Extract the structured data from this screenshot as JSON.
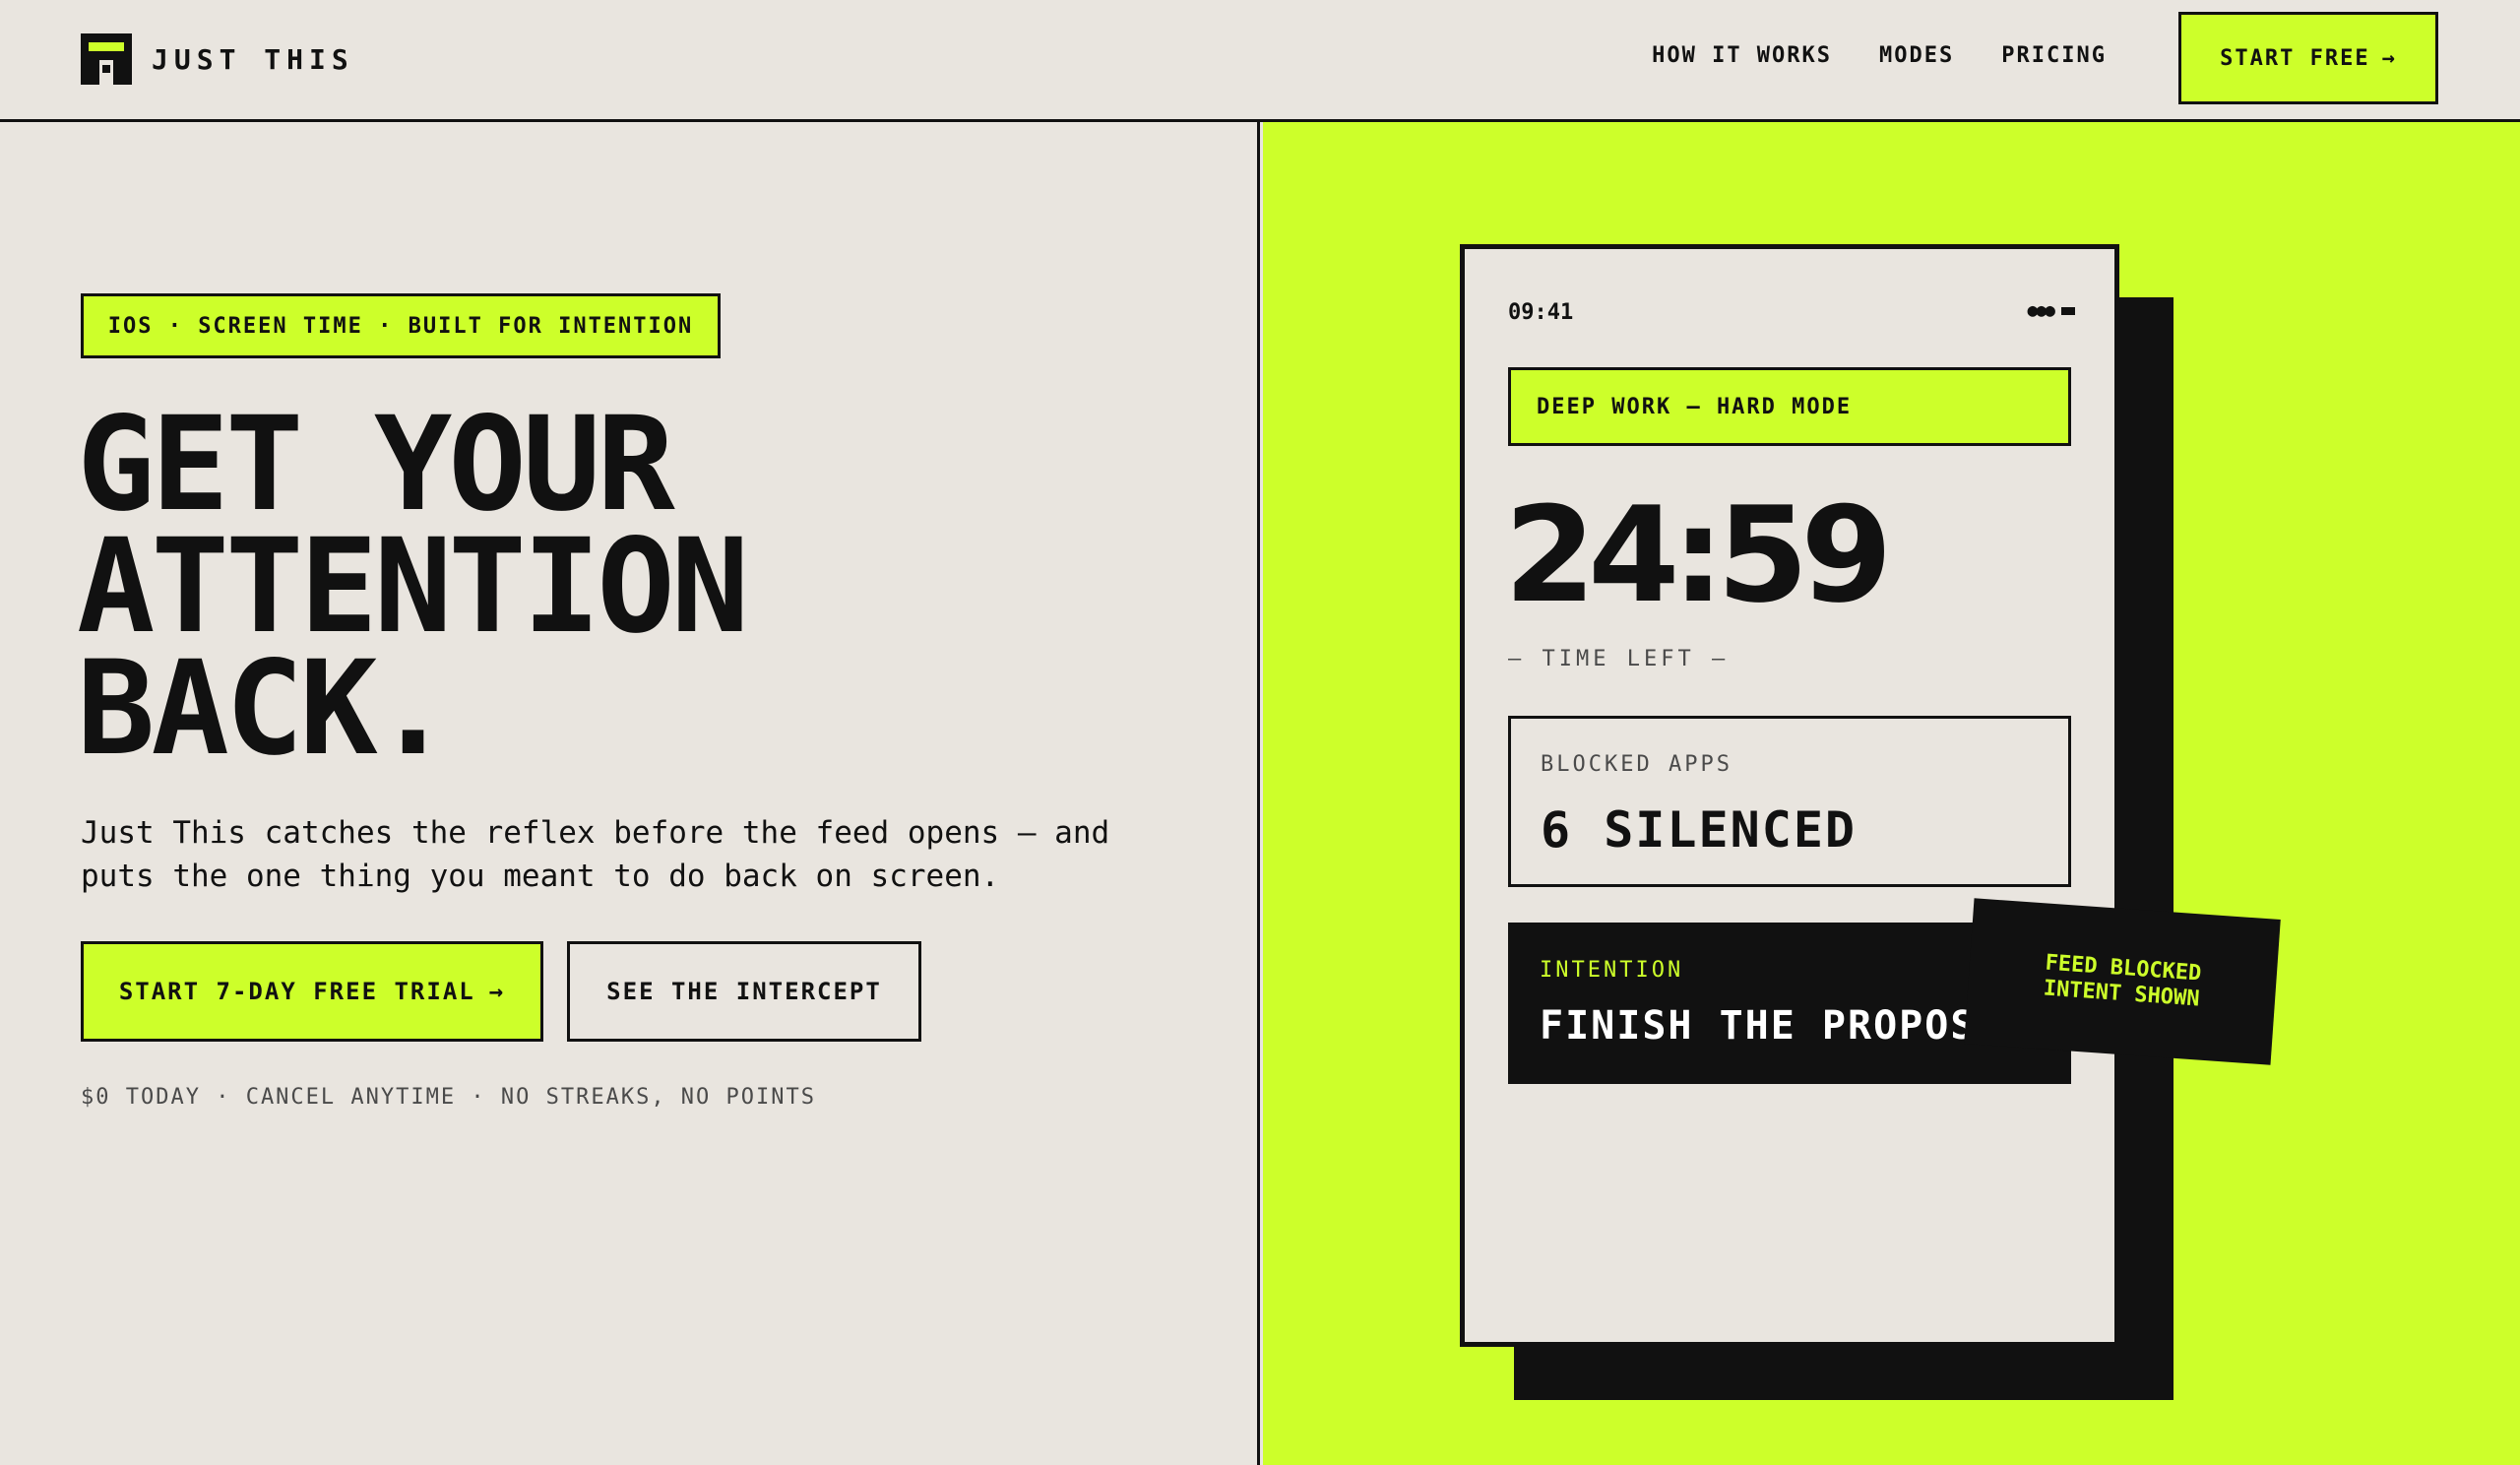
{
  "colors": {
    "accent": "#cdff2a",
    "ink": "#111111",
    "paper": "#e9e5df",
    "muted": "#4a4a4a"
  },
  "nav": {
    "brand": "JUST THIS",
    "links": [
      "HOW IT WORKS",
      "MODES",
      "PRICING"
    ],
    "cta_label": "START FREE",
    "cta_icon": "arrow-right-icon",
    "cta_arrow": "→"
  },
  "hero": {
    "eyebrow": "IOS · SCREEN TIME · BUILT FOR INTENTION",
    "headline": [
      "GET YOUR",
      "ATTENTION",
      "BACK."
    ],
    "subcopy": "Just This catches the reflex before the feed opens — and puts the one thing you meant to do back on screen.",
    "primary_cta": "START 7-DAY FREE TRIAL",
    "primary_cta_arrow": "→",
    "secondary_cta": "SEE THE INTERCEPT",
    "fineprint": "$0 TODAY · CANCEL ANYTIME · NO STREAKS, NO POINTS"
  },
  "phone": {
    "status_time": "09:41",
    "status_signal": "●●●",
    "mode": "DEEP WORK — HARD MODE",
    "timer": "24:59",
    "timer_label": "— TIME LEFT —",
    "blocked_label": "BLOCKED APPS",
    "blocked_value": "6 SILENCED",
    "intention_label": "INTENTION",
    "intention_value": "FINISH THE PROPOSAL"
  },
  "sticker": {
    "line1": "FEED BLOCKED",
    "line2": "INTENT SHOWN"
  }
}
